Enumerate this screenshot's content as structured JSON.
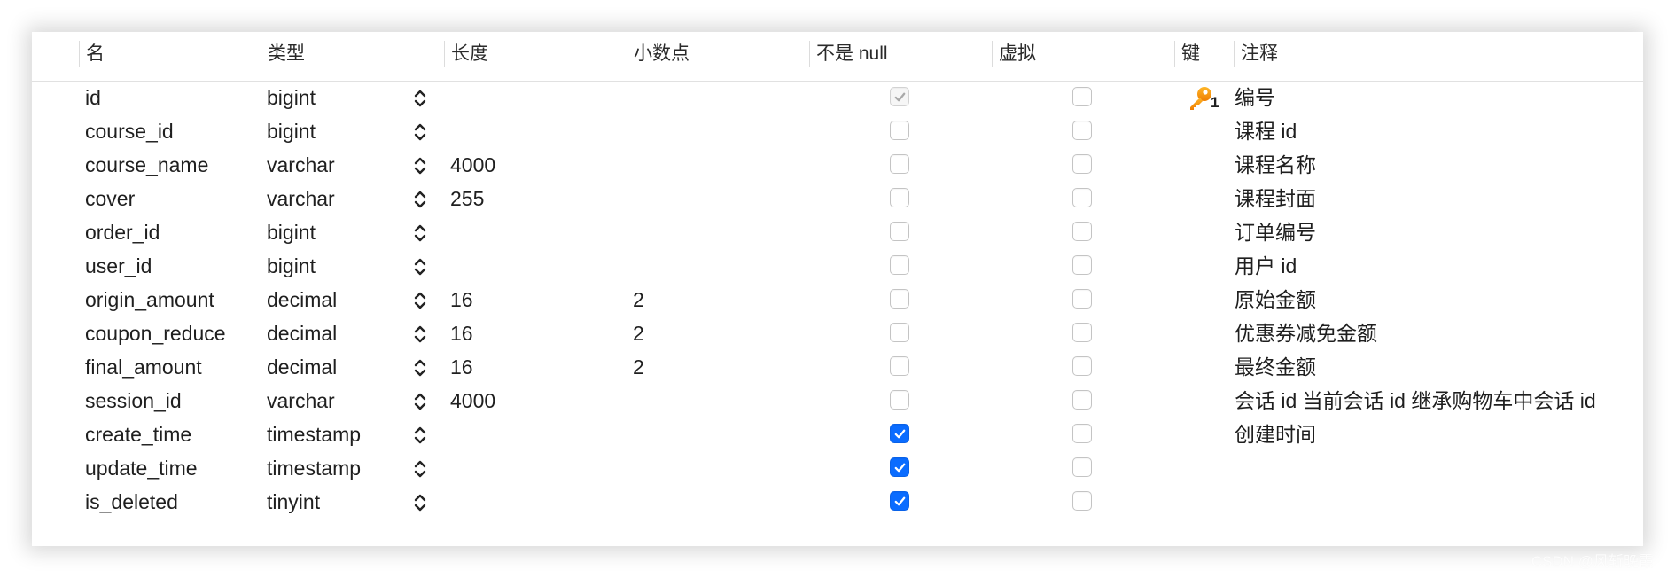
{
  "columns": [
    "名",
    "类型",
    "长度",
    "小数点",
    "不是 null",
    "虚拟",
    "键",
    "注释"
  ],
  "accent_color": "#0a6cff",
  "key_color": "#f29a0c",
  "rows": [
    {
      "name": "id",
      "type": "bigint",
      "length": "",
      "decimals": "",
      "not_null": "disabled-checked",
      "virtual": false,
      "key": "1",
      "comment": "编号"
    },
    {
      "name": "course_id",
      "type": "bigint",
      "length": "",
      "decimals": "",
      "not_null": false,
      "virtual": false,
      "key": "",
      "comment": "课程 id"
    },
    {
      "name": "course_name",
      "type": "varchar",
      "length": "4000",
      "decimals": "",
      "not_null": false,
      "virtual": false,
      "key": "",
      "comment": "课程名称"
    },
    {
      "name": "cover",
      "type": "varchar",
      "length": "255",
      "decimals": "",
      "not_null": false,
      "virtual": false,
      "key": "",
      "comment": "课程封面"
    },
    {
      "name": "order_id",
      "type": "bigint",
      "length": "",
      "decimals": "",
      "not_null": false,
      "virtual": false,
      "key": "",
      "comment": "订单编号"
    },
    {
      "name": "user_id",
      "type": "bigint",
      "length": "",
      "decimals": "",
      "not_null": false,
      "virtual": false,
      "key": "",
      "comment": "用户 id"
    },
    {
      "name": "origin_amount",
      "type": "decimal",
      "length": "16",
      "decimals": "2",
      "not_null": false,
      "virtual": false,
      "key": "",
      "comment": "原始金额"
    },
    {
      "name": "coupon_reduce",
      "type": "decimal",
      "length": "16",
      "decimals": "2",
      "not_null": false,
      "virtual": false,
      "key": "",
      "comment": "优惠券减免金额"
    },
    {
      "name": "final_amount",
      "type": "decimal",
      "length": "16",
      "decimals": "2",
      "not_null": false,
      "virtual": false,
      "key": "",
      "comment": "最终金额"
    },
    {
      "name": "session_id",
      "type": "varchar",
      "length": "4000",
      "decimals": "",
      "not_null": false,
      "virtual": false,
      "key": "",
      "comment": "会话 id 当前会话 id 继承购物车中会话 id"
    },
    {
      "name": "create_time",
      "type": "timestamp",
      "length": "",
      "decimals": "",
      "not_null": true,
      "virtual": false,
      "key": "",
      "comment": "创建时间"
    },
    {
      "name": "update_time",
      "type": "timestamp",
      "length": "",
      "decimals": "",
      "not_null": true,
      "virtual": false,
      "key": "",
      "comment": ""
    },
    {
      "name": "is_deleted",
      "type": "tinyint",
      "length": "",
      "decimals": "",
      "not_null": true,
      "virtual": false,
      "key": "",
      "comment": ""
    }
  ],
  "icons": {
    "type_stepper": "up-down-chevron-icon",
    "primary_key": "key-icon"
  },
  "watermark": "CSDN @风斩晚霞"
}
